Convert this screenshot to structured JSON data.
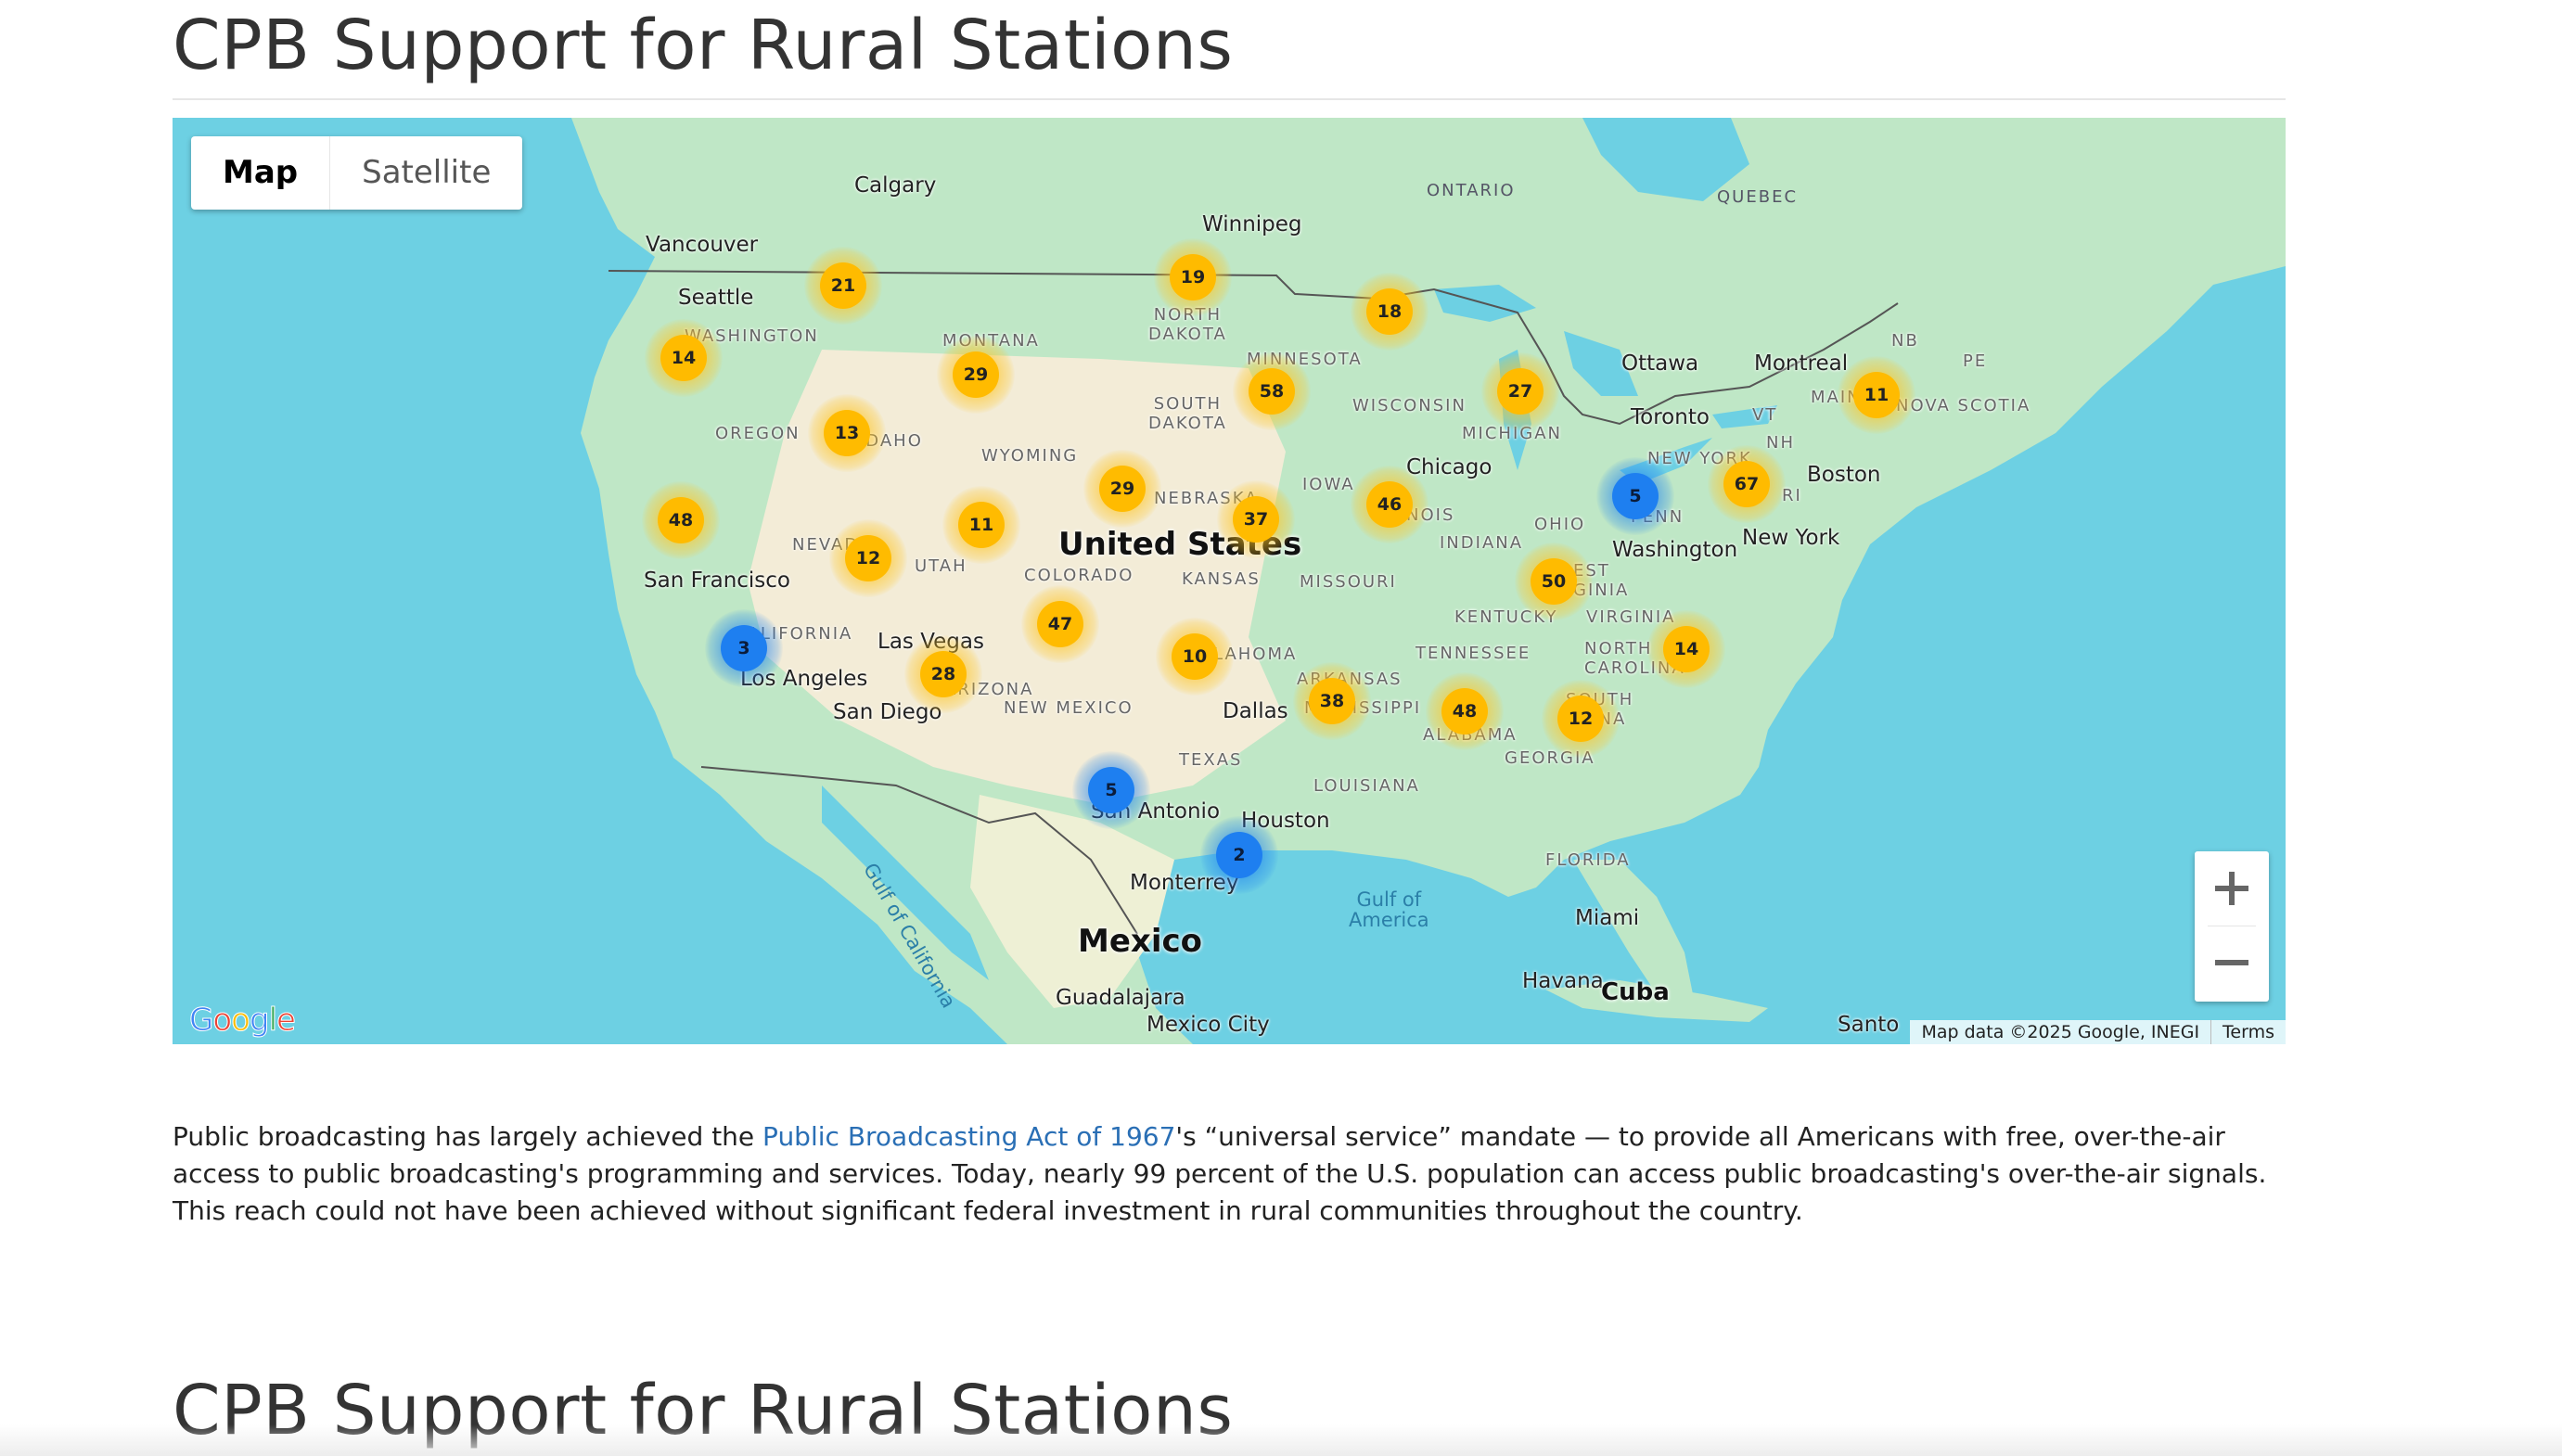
{
  "page": {
    "title": "CPB Support for Rural Stations",
    "title_repeat": "CPB Support for Rural Stations"
  },
  "map": {
    "type_controls": {
      "map": "Map",
      "satellite": "Satellite",
      "active": "Map"
    },
    "zoom": {
      "in_icon": "plus-icon",
      "out_icon": "minus-icon"
    },
    "attribution": {
      "data": "Map data ©2025 Google, INEGI",
      "terms": "Terms"
    },
    "logo": "Google",
    "labels": {
      "cities": {
        "calgary": "Calgary",
        "winnipeg": "Winnipeg",
        "vancouver": "Vancouver",
        "seattle": "Seattle",
        "ottawa": "Ottawa",
        "montreal": "Montreal",
        "toronto": "Toronto",
        "chicago": "Chicago",
        "boston": "Boston",
        "new_york": "New York",
        "washington": "Washington",
        "san_francisco": "San Francisco",
        "las_vegas": "Las Vegas",
        "los_angeles": "Los Angeles",
        "san_diego": "San Diego",
        "dallas": "Dallas",
        "houston": "Houston",
        "san_antonio": "San Antonio",
        "monterrey": "Monterrey",
        "miami": "Miami",
        "havana": "Havana",
        "guadalajara": "Guadalajara",
        "mexico_city": "Mexico City",
        "santo": "Santo"
      },
      "countries": {
        "us": "United States",
        "mexico": "Mexico",
        "cuba": "Cuba"
      },
      "water": {
        "gulf_mexico": "Gulf of\nAmerica",
        "gulf_california": "Gulf of California"
      },
      "regions": {
        "ontario": "ONTARIO",
        "quebec": "QUEBEC",
        "washington": "WASHINGTON",
        "montana": "MONTANA",
        "north_dakota": "NORTH\nDAKOTA",
        "minnesota": "MINNESOTA",
        "south_dakota": "SOUTH\nDAKOTA",
        "wisconsin": "WISCONSIN",
        "michigan": "MICHIGAN",
        "oregon": "OREGON",
        "idaho": "IDAHO",
        "wyoming": "WYOMING",
        "nebraska": "NEBRASKA",
        "iowa": "IOWA",
        "nevada": "NEVADA",
        "utah": "UTAH",
        "colorado": "COLORADO",
        "kansas": "KANSAS",
        "missouri": "MISSOURI",
        "illinois": "NOIS",
        "indiana": "INDIANA",
        "ohio": "OHIO",
        "penn": "PENN",
        "new_york": "NEW YORK",
        "maine": "MAIN",
        "nb": "NB",
        "pe": "PE",
        "nova_scotia": "NOVA SCOTIA",
        "vt": "VT",
        "nh": "NH",
        "ri": "RI",
        "ma": "MA",
        "california": "CALIFORNIA",
        "arizona": "ARIZONA",
        "new_mexico": "NEW MEXICO",
        "oklahoma": "LAHOMA",
        "arkansas": "ARKANSAS",
        "tennessee": "TENNESSEE",
        "kentucky": "KENTUCKY",
        "west_virginia": "EST\nGINIA",
        "virginia": "VIRGINIA",
        "north_carolina": "NORTH\nCAROLINA",
        "south_carolina": "SOUTH\nOLINA",
        "mississippi": "MISSISSIPPI",
        "alabama": "ALABAMA",
        "georgia": "GEORGIA",
        "texas": "TEXAS",
        "louisiana": "LOUISIANA",
        "florida": "FLORIDA"
      }
    },
    "clusters": [
      {
        "count": "21",
        "color": "yellow"
      },
      {
        "count": "19",
        "color": "yellow"
      },
      {
        "count": "18",
        "color": "yellow"
      },
      {
        "count": "14",
        "color": "yellow"
      },
      {
        "count": "29",
        "color": "yellow"
      },
      {
        "count": "58",
        "color": "yellow"
      },
      {
        "count": "27",
        "color": "yellow"
      },
      {
        "count": "11",
        "color": "yellow"
      },
      {
        "count": "13",
        "color": "yellow"
      },
      {
        "count": "48",
        "color": "yellow"
      },
      {
        "count": "12",
        "color": "yellow"
      },
      {
        "count": "11",
        "color": "yellow"
      },
      {
        "count": "29",
        "color": "yellow"
      },
      {
        "count": "37",
        "color": "yellow"
      },
      {
        "count": "46",
        "color": "yellow"
      },
      {
        "count": "5",
        "color": "blue"
      },
      {
        "count": "67",
        "color": "yellow"
      },
      {
        "count": "50",
        "color": "yellow"
      },
      {
        "count": "3",
        "color": "blue"
      },
      {
        "count": "47",
        "color": "yellow"
      },
      {
        "count": "28",
        "color": "yellow"
      },
      {
        "count": "10",
        "color": "yellow"
      },
      {
        "count": "38",
        "color": "yellow"
      },
      {
        "count": "48",
        "color": "yellow"
      },
      {
        "count": "12",
        "color": "yellow"
      },
      {
        "count": "14",
        "color": "yellow"
      },
      {
        "count": "5",
        "color": "blue"
      },
      {
        "count": "2",
        "color": "blue"
      }
    ]
  },
  "body": {
    "text_before": "Public broadcasting has largely achieved the ",
    "link": "Public Broadcasting Act of 1967",
    "text_after": "'s “universal service” mandate — to provide all Americans with free, over-the-air access to public broadcasting's programming and services. Today, nearly 99 percent of the U.S. population can access public broadcasting's over-the-air signals. This reach could not have been achieved without significant federal investment in rural communities throughout the country."
  },
  "colors": {
    "ocean": "#6dd0e3",
    "land_green": "#bfe7c6",
    "land_dry": "#f3ecd7",
    "cluster_yellow": "#ffbb00",
    "cluster_blue": "#1e7ff0",
    "link": "#2a6fb5"
  }
}
